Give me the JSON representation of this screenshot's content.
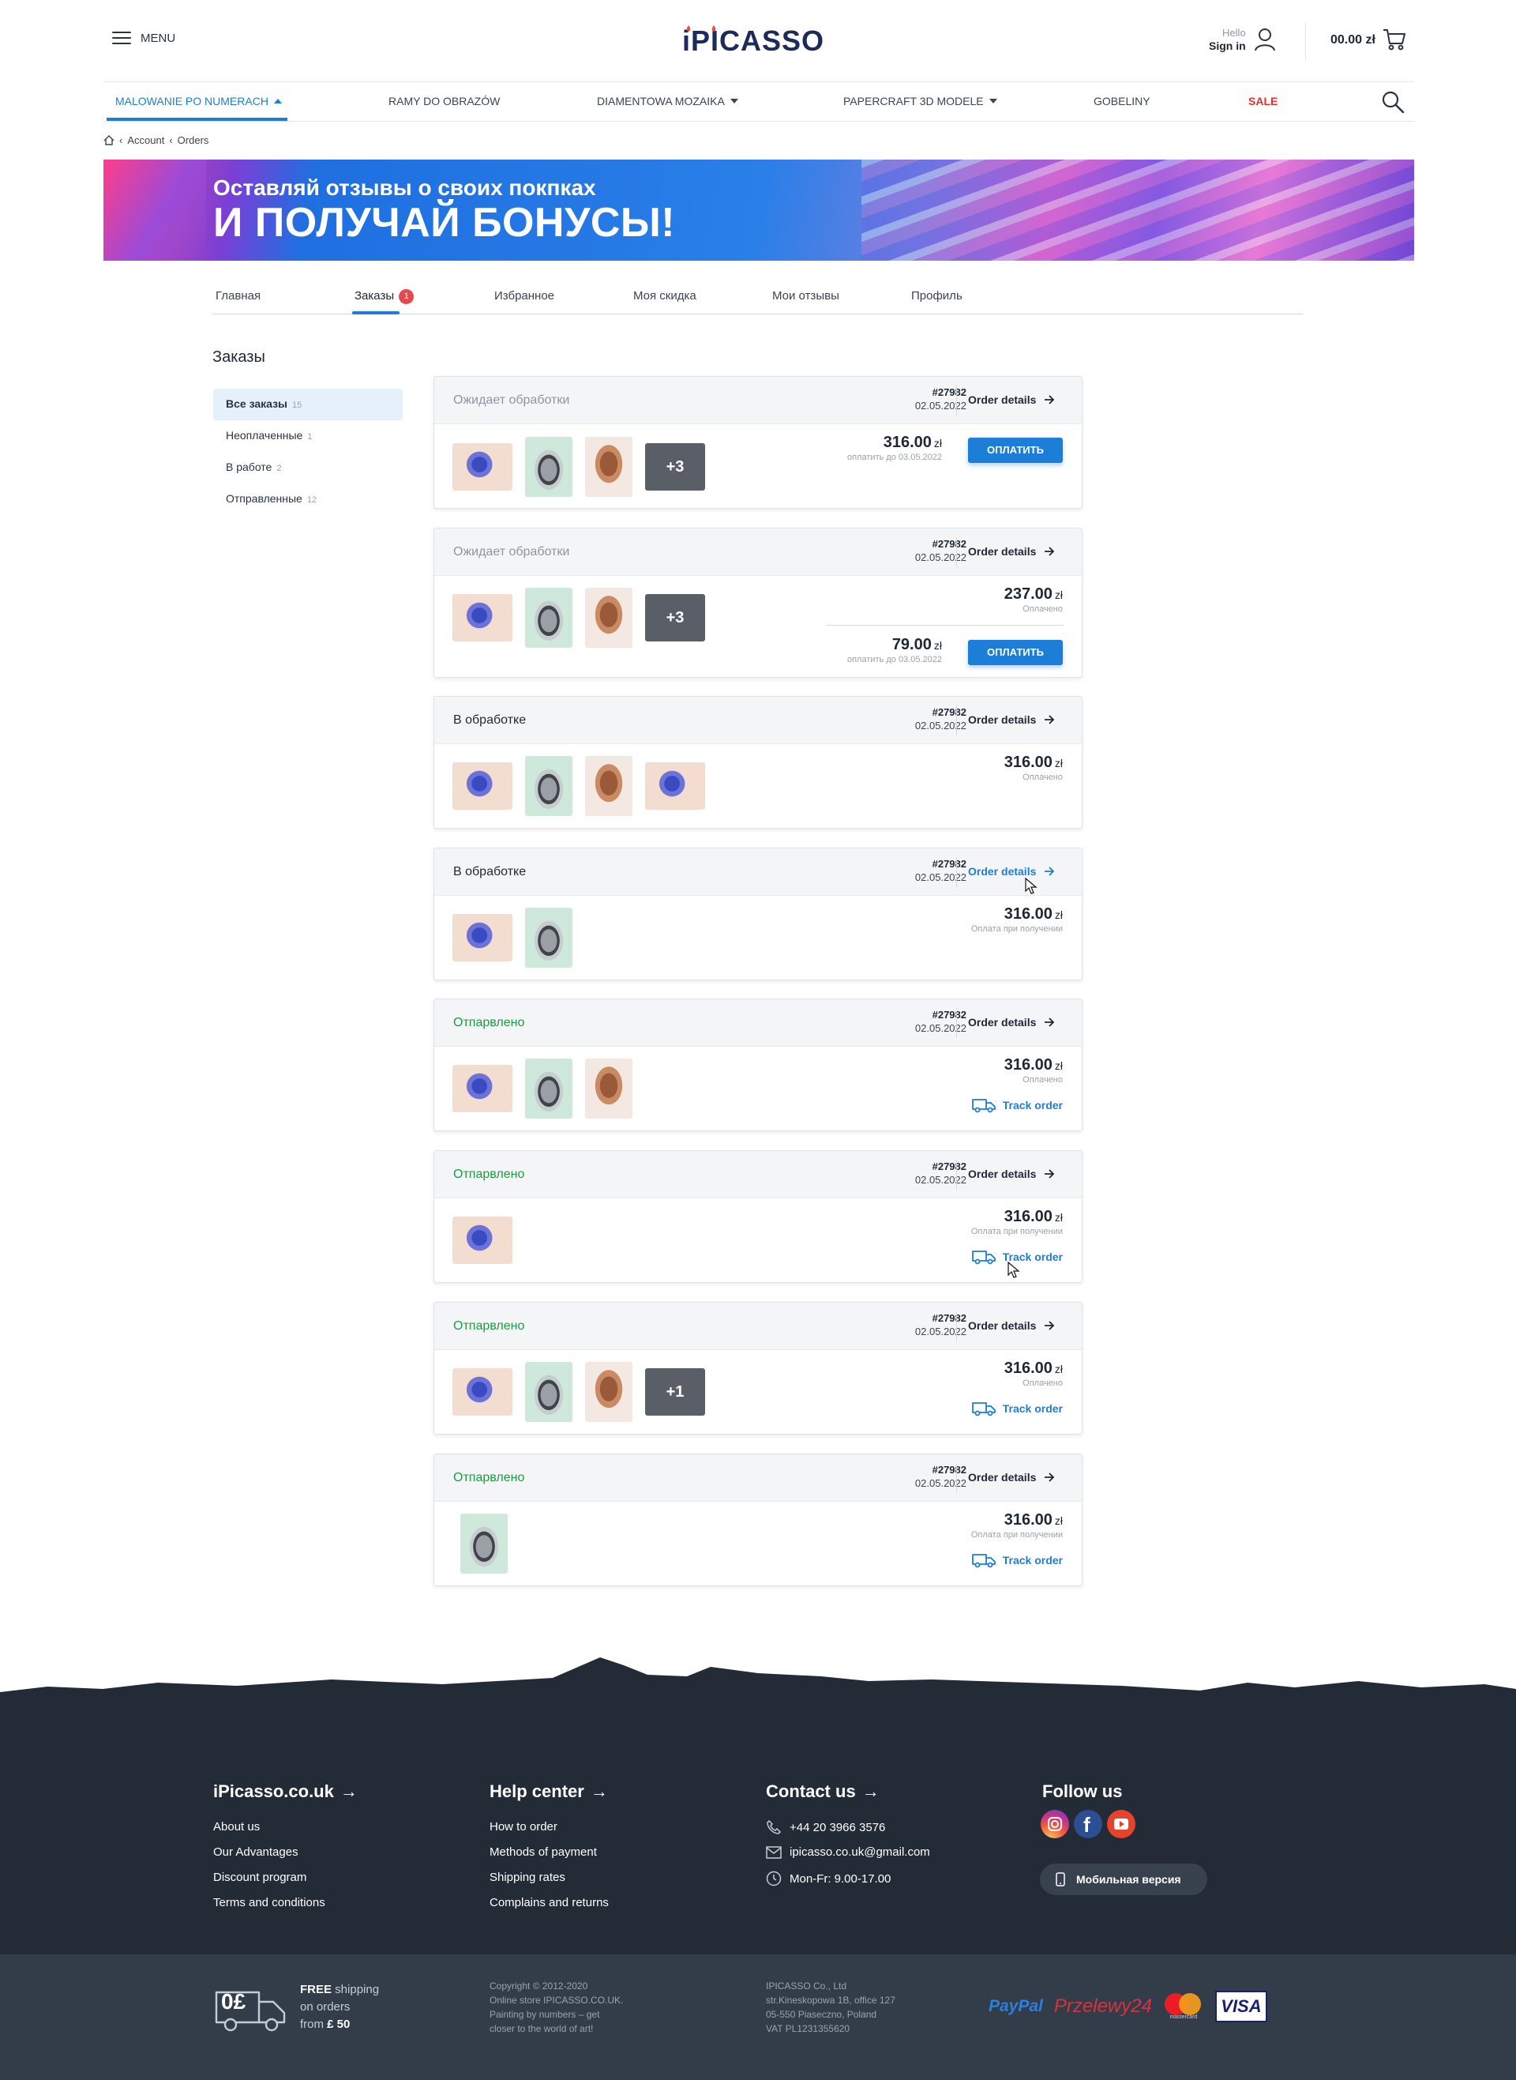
{
  "header": {
    "menu_label": "MENU",
    "logo": "iPICASSO",
    "hello": "Hello",
    "sign_in": "Sign in",
    "cart_total": "00.00 zł"
  },
  "nav": {
    "items": [
      {
        "label": "MALOWANIE PO NUMERACH",
        "active": true,
        "caret": true
      },
      {
        "label": "RAMY DO OBRAZÓW"
      },
      {
        "label": "DIAMENTOWA MOZAIKA",
        "caret": true
      },
      {
        "label": "PAPERCRAFT 3D MODELE",
        "caret": true
      },
      {
        "label": "GOBELINY"
      },
      {
        "label": "SALE",
        "sale": true
      }
    ]
  },
  "breadcrumb": [
    "Account",
    "Orders"
  ],
  "banner": {
    "line1": "Оставляй отзывы о своих покпках",
    "line2": "И ПОЛУЧАЙ БОНУСЫ!"
  },
  "tabs": [
    {
      "label": "Главная"
    },
    {
      "label": "Заказы",
      "badge": "1",
      "active": true
    },
    {
      "label": "Избранное"
    },
    {
      "label": "Моя скидка"
    },
    {
      "label": "Мои отзывы"
    },
    {
      "label": "Профиль"
    }
  ],
  "sidebar": {
    "title": "Заказы",
    "items": [
      {
        "label": "Все заказы",
        "count": "15",
        "active": true
      },
      {
        "label": "Неоплаченные",
        "count": "1"
      },
      {
        "label": "В работе",
        "count": "2"
      },
      {
        "label": "Отправленные",
        "count": "12"
      }
    ]
  },
  "order_common": {
    "details_label": "Order details",
    "pay_label": "ОПЛАТИТЬ",
    "track_label": "Track order",
    "currency": "zł"
  },
  "orders": [
    {
      "status": "Ожидает обработки",
      "number": "#27982",
      "date": "02.05.2022",
      "more": "+3",
      "price": "316.00",
      "price_note": "оплатить до 03.05.2022"
    },
    {
      "status": "Ожидает обработки",
      "number": "#27982",
      "date": "02.05.2022",
      "more": "+3",
      "price": "237.00",
      "price_note": "Оплачено",
      "price2": "79.00",
      "price2_note": "оплатить до 03.05.2022"
    },
    {
      "status": "В обработке",
      "number": "#27982",
      "date": "02.05.2022",
      "price": "316.00",
      "price_note": "Оплачено"
    },
    {
      "status": "В обработке",
      "number": "#27982",
      "date": "02.05.2022",
      "price": "316.00",
      "price_note": "Оплата при получении"
    },
    {
      "status": "Отпарвлено",
      "number": "#27982",
      "date": "02.05.2022",
      "price": "316.00",
      "price_note": "Оплачено"
    },
    {
      "status": "Отпарвлено",
      "number": "#27982",
      "date": "02.05.2022",
      "price": "316.00",
      "price_note": "Оплата при получении"
    },
    {
      "status": "Отпарвлено",
      "number": "#27982",
      "date": "02.05.2022",
      "more": "+1",
      "price": "316.00",
      "price_note": "Оплачено"
    },
    {
      "status": "Отпарвлено",
      "number": "#27982",
      "date": "02.05.2022",
      "price": "316.00",
      "price_note": "Оплата при получении"
    }
  ],
  "footer": {
    "col1": {
      "title": "iPicasso.co.uk",
      "links": [
        "About us",
        "Our Advantages",
        "Discount program",
        "Terms and conditions"
      ]
    },
    "col2": {
      "title": "Help center",
      "links": [
        "How to order",
        "Methods of payment",
        "Shipping rates",
        "Complains and returns"
      ]
    },
    "col3": {
      "title": "Contact us",
      "phone": "+44 20 3966 3576",
      "email": "ipicasso.co.uk@gmail.com",
      "hours": "Mon-Fr: 9.00-17.00"
    },
    "col4": {
      "title": "Follow us",
      "mobile": "Мобильная версия"
    },
    "shipping": {
      "icon_text": "0£",
      "free": "FREE",
      "line1": " shipping",
      "line2": "on orders",
      "line3": "from ",
      "amount": "£ 50"
    },
    "copyright": [
      "Copyright © 2012-2020",
      "Online store IPICASSO.CO.UK.",
      "Painting by numbers – get",
      "closer to the world of art!"
    ],
    "company": [
      "IPICASSO Co., Ltd",
      "str.Kineskopowa 1B, office 127",
      "05-550 Piaseczno, Poland",
      "VAT PL1231355620"
    ],
    "payments": [
      "PayPal",
      "Przelewy24",
      "mastercard",
      "VISA"
    ]
  },
  "colors": {
    "accent": "#1c7ed6",
    "sent": "#1e9a42",
    "footer": "#232b36",
    "sale": "#e03131"
  }
}
